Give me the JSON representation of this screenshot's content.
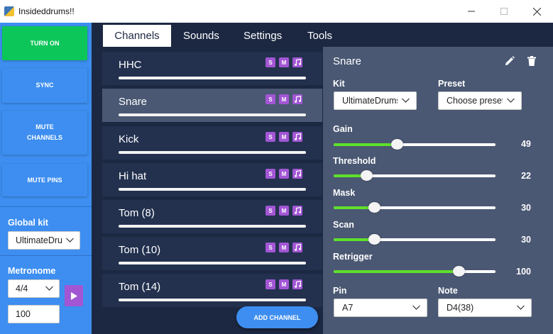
{
  "window": {
    "title": "Insideddrums!!",
    "icon": "python-icon"
  },
  "sidebar": {
    "turn_on": "TURN ON",
    "sync": "SYNC",
    "mute_channels_line1": "MUTE",
    "mute_channels_line2": "CHANNELS",
    "mute_pins": "MUTE PINS",
    "global_kit_label": "Global kit",
    "global_kit_value": "UltimateDrums",
    "metronome_label": "Metronome",
    "time_signature": "4/4",
    "tempo": "100"
  },
  "tabs": [
    {
      "label": "Channels",
      "active": true
    },
    {
      "label": "Sounds",
      "active": false
    },
    {
      "label": "Settings",
      "active": false
    },
    {
      "label": "Tools",
      "active": false
    }
  ],
  "channels": [
    {
      "name": "HHC",
      "selected": false
    },
    {
      "name": "Snare",
      "selected": true
    },
    {
      "name": "Kick",
      "selected": false
    },
    {
      "name": "Hi hat",
      "selected": false
    },
    {
      "name": "Tom (8)",
      "selected": false
    },
    {
      "name": "Tom (10)",
      "selected": false
    },
    {
      "name": "Tom (14)",
      "selected": false
    }
  ],
  "badges": {
    "solo": "S",
    "mute": "M",
    "sound": "music-note-icon"
  },
  "add_channel": "ADD CHANNEL",
  "detail": {
    "title": "Snare",
    "kit_label": "Kit",
    "kit_value": "UltimateDrums",
    "preset_label": "Preset",
    "preset_value": "Choose preset",
    "pin_label": "Pin",
    "pin_value": "A7",
    "note_label": "Note",
    "note_value": "D4(38)",
    "sliders": [
      {
        "label": "Gain",
        "value": "49",
        "fraction": 0.39
      },
      {
        "label": "Threshold",
        "value": "22",
        "fraction": 0.2
      },
      {
        "label": "Mask",
        "value": "30",
        "fraction": 0.25
      },
      {
        "label": "Scan",
        "value": "30",
        "fraction": 0.25
      },
      {
        "label": "Retrigger",
        "value": "100",
        "fraction": 0.77
      }
    ]
  },
  "colors": {
    "accent_blue": "#3d8ef0",
    "turn_on_green": "#0cc65a",
    "badge_purple": "#a256d4",
    "slider_green": "#5fe02b",
    "dark_bg": "#1c2842",
    "panel_bg": "#4a5873"
  }
}
